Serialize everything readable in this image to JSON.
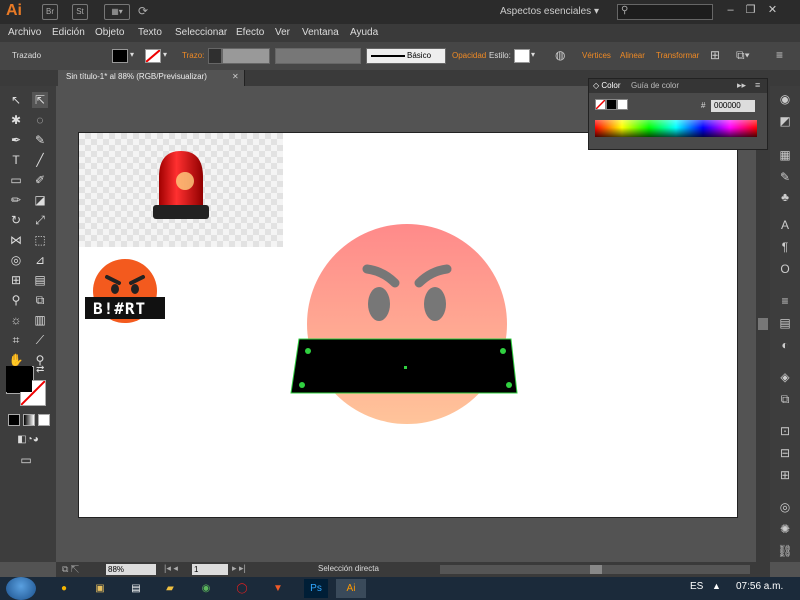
{
  "app": {
    "logo": "Ai",
    "bridge_label": "Br",
    "stock_label": "St",
    "workspace": "Aspectos esenciales",
    "window_minimize": "–",
    "window_restore": "❐",
    "window_close": "✕"
  },
  "menu": [
    "Archivo",
    "Edición",
    "Objeto",
    "Texto",
    "Seleccionar",
    "Efecto",
    "Ver",
    "Ventana",
    "Ayuda"
  ],
  "control": {
    "mode": "Trazado",
    "trazo_label": "Trazo:",
    "profile": "Básico",
    "opacidad": "Opacidad",
    "estilo": "Estilo:",
    "vertices": "Vértices",
    "alinear": "Alinear",
    "transformar": "Transformar"
  },
  "document": {
    "tab_title": "Sin título-1* al 88% (RGB/Previsualizar)",
    "tab_close": "✕"
  },
  "color_panel": {
    "tab_color": "Color",
    "tab_guide": "Guía de color",
    "hash": "#",
    "hex": "000000"
  },
  "artwork": {
    "badge_text": "B!#RT"
  },
  "status": {
    "zoom": "88%",
    "page": "1",
    "tool": "Selección directa"
  },
  "taskbar": {
    "lang": "ES",
    "time": "07:56 a.m.",
    "ps_label": "Ps",
    "ai_label": "Ai"
  },
  "colors": {
    "accent_orange": "#f08a24",
    "face_top": "#ff8a8a",
    "face_bottom": "#ffc49a",
    "selection_green": "#30d040"
  }
}
